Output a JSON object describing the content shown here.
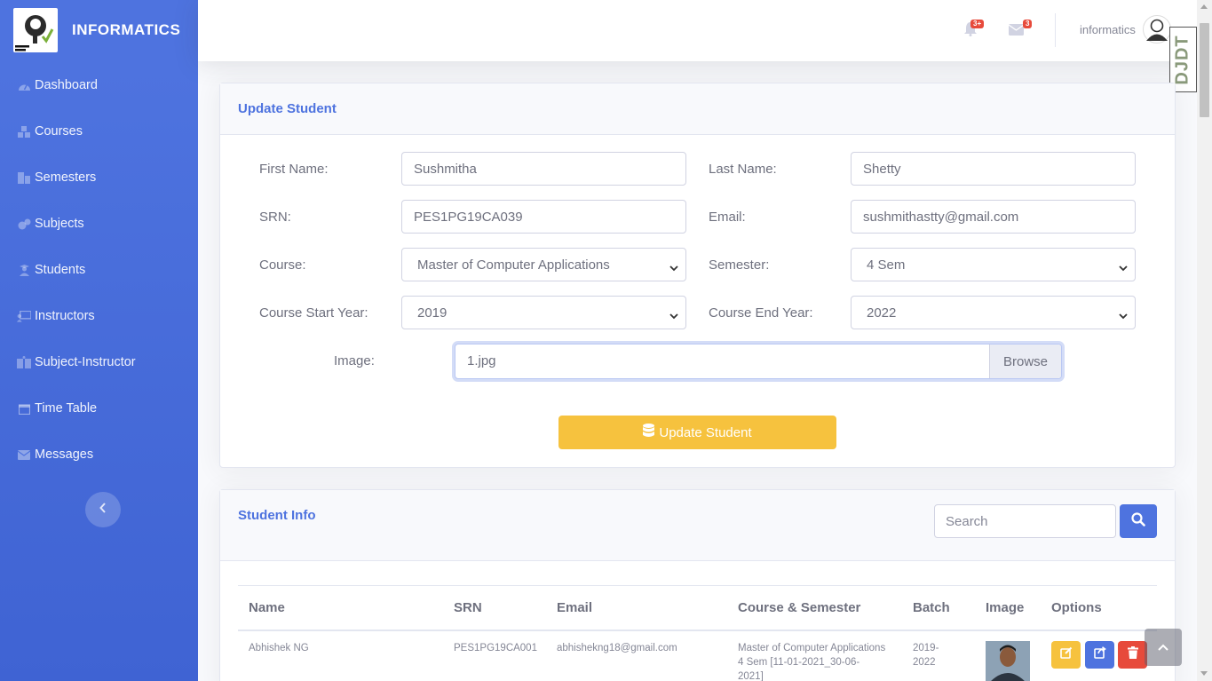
{
  "brand": {
    "name": "INFORMATICS"
  },
  "sidebar": {
    "items": [
      {
        "label": "Dashboard",
        "icon": "dashboard-icon"
      },
      {
        "label": "Courses",
        "icon": "cubes-icon"
      },
      {
        "label": "Semesters",
        "icon": "building-icon"
      },
      {
        "label": "Subjects",
        "icon": "cogs-icon"
      },
      {
        "label": "Students",
        "icon": "user-graduate-icon"
      },
      {
        "label": "Instructors",
        "icon": "chalkboard-teacher-icon"
      },
      {
        "label": "Subject-Instructor",
        "icon": "book-reader-icon"
      },
      {
        "label": "Time Table",
        "icon": "calendar-icon"
      },
      {
        "label": "Messages",
        "icon": "envelope-icon"
      }
    ],
    "toggle_icon": "chevron-left-icon"
  },
  "topbar": {
    "alerts_count": "3+",
    "messages_count": "3",
    "username": "informatics",
    "extension_badge": "DJDT"
  },
  "update_form": {
    "title": "Update Student",
    "first_name_label": "First Name:",
    "first_name_value": "Sushmitha",
    "last_name_label": "Last Name:",
    "last_name_value": "Shetty",
    "srn_label": "SRN:",
    "srn_value": "PES1PG19CA039",
    "email_label": "Email:",
    "email_value": "sushmithastty@gmail.com",
    "course_label": "Course:",
    "course_value": "Master of Computer Applications",
    "semester_label": "Semester:",
    "semester_value": "4 Sem",
    "start_year_label": "Course Start Year:",
    "start_year_value": "2019",
    "end_year_label": "Course End Year:",
    "end_year_value": "2022",
    "image_label": "Image:",
    "image_value": "1.jpg",
    "browse_label": "Browse",
    "submit_label": "Update Student"
  },
  "student_info": {
    "title": "Student Info",
    "search_placeholder": "Search",
    "columns": [
      "Name",
      "SRN",
      "Email",
      "Course & Semester",
      "Batch",
      "Image",
      "Options"
    ],
    "rows": [
      {
        "name": "Abhishek NG",
        "srn": "PES1PG19CA001",
        "email": "abhishekng18@gmail.com",
        "course_line1": "Master of Computer Applications",
        "course_line2": "4 Sem [11-01-2021_30-06-",
        "course_line3": "2021]",
        "batch_line1": "2019-",
        "batch_line2": "2022"
      }
    ]
  },
  "colors": {
    "primary": "#4e73df",
    "warning": "#f6c23e",
    "danger": "#e74a3b"
  }
}
